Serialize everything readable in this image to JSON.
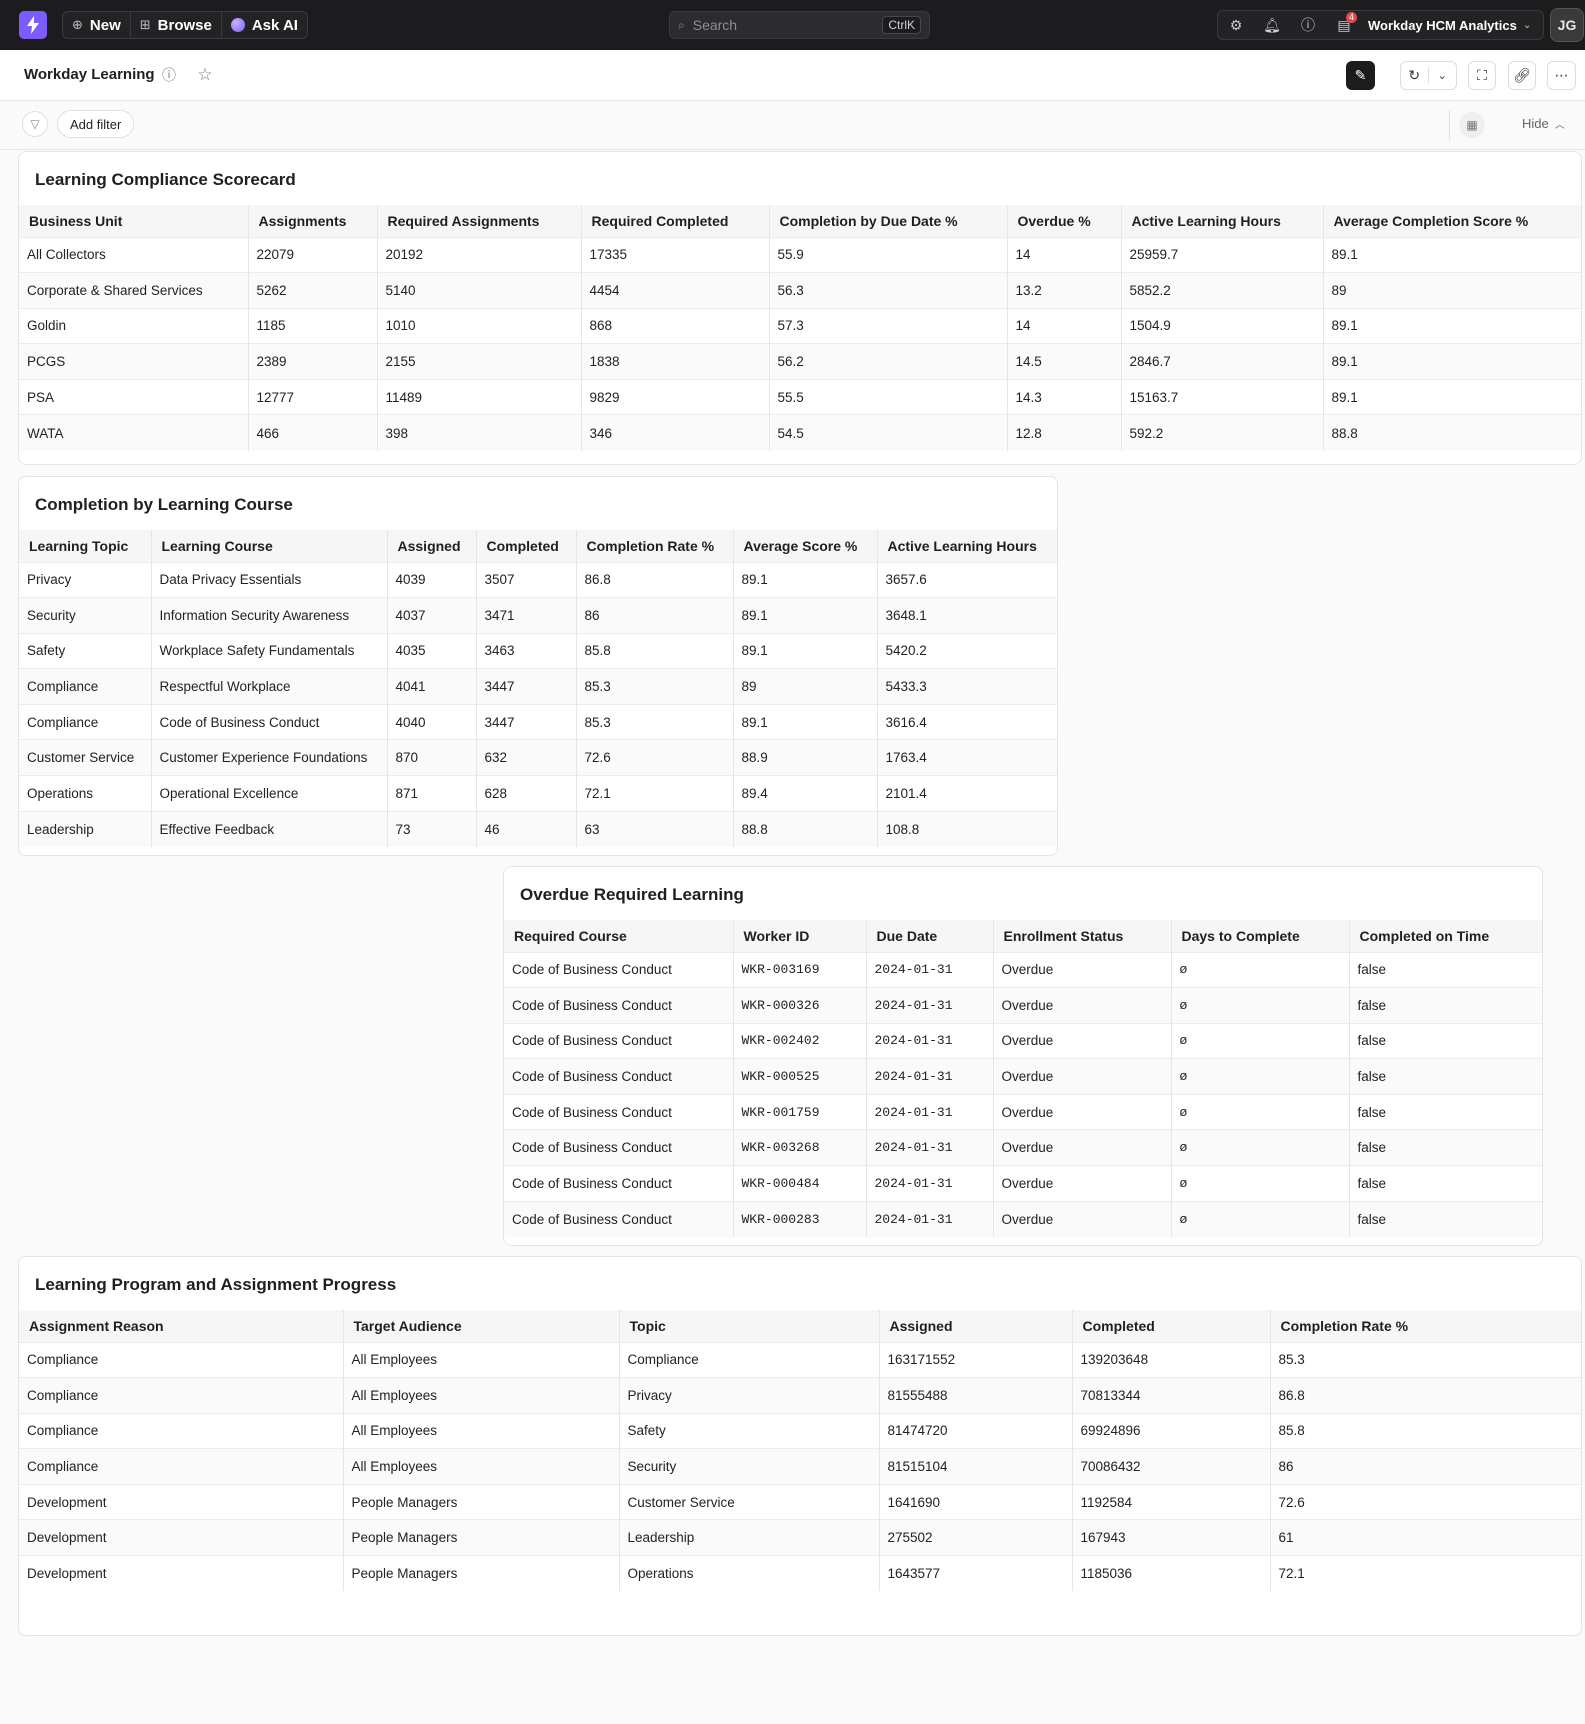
{
  "nav": {
    "new_label": "New",
    "browse_label": "Browse",
    "ask_ai_label": "Ask AI",
    "search_placeholder": "Search",
    "search_shortcut": "CtrlK",
    "notification_count": "4",
    "org_name": "Workday HCM Analytics",
    "avatar_initials": "JG"
  },
  "titlebar": {
    "title": "Workday Learning"
  },
  "filterbar": {
    "add_filter_label": "Add filter",
    "hide_label": "Hide"
  },
  "scorecard": {
    "title": "Learning Compliance Scorecard",
    "columns": [
      "Business Unit",
      "Assignments",
      "Required Assignments",
      "Required Completed",
      "Completion by Due Date %",
      "Overdue %",
      "Active Learning Hours",
      "Average Completion Score %"
    ],
    "rows": [
      [
        "All Collectors",
        "22079",
        "20192",
        "17335",
        "55.9",
        "14",
        "25959.7",
        "89.1"
      ],
      [
        "Corporate & Shared Services",
        "5262",
        "5140",
        "4454",
        "56.3",
        "13.2",
        "5852.2",
        "89"
      ],
      [
        "Goldin",
        "1185",
        "1010",
        "868",
        "57.3",
        "14",
        "1504.9",
        "89.1"
      ],
      [
        "PCGS",
        "2389",
        "2155",
        "1838",
        "56.2",
        "14.5",
        "2846.7",
        "89.1"
      ],
      [
        "PSA",
        "12777",
        "11489",
        "9829",
        "55.5",
        "14.3",
        "15163.7",
        "89.1"
      ],
      [
        "WATA",
        "466",
        "398",
        "346",
        "54.5",
        "12.8",
        "592.2",
        "88.8"
      ]
    ]
  },
  "course": {
    "title": "Completion by Learning Course",
    "columns": [
      "Learning Topic",
      "Learning Course",
      "Assigned",
      "Completed",
      "Completion Rate %",
      "Average Score %",
      "Active Learning Hours"
    ],
    "rows": [
      [
        "Privacy",
        "Data Privacy Essentials",
        "4039",
        "3507",
        "86.8",
        "89.1",
        "3657.6"
      ],
      [
        "Security",
        "Information Security Awareness",
        "4037",
        "3471",
        "86",
        "89.1",
        "3648.1"
      ],
      [
        "Safety",
        "Workplace Safety Fundamentals",
        "4035",
        "3463",
        "85.8",
        "89.1",
        "5420.2"
      ],
      [
        "Compliance",
        "Respectful Workplace",
        "4041",
        "3447",
        "85.3",
        "89",
        "5433.3"
      ],
      [
        "Compliance",
        "Code of Business Conduct",
        "4040",
        "3447",
        "85.3",
        "89.1",
        "3616.4"
      ],
      [
        "Customer Service",
        "Customer Experience Foundations",
        "870",
        "632",
        "72.6",
        "88.9",
        "1763.4"
      ],
      [
        "Operations",
        "Operational Excellence",
        "871",
        "628",
        "72.1",
        "89.4",
        "2101.4"
      ],
      [
        "Leadership",
        "Effective Feedback",
        "73",
        "46",
        "63",
        "88.8",
        "108.8"
      ]
    ]
  },
  "overdue": {
    "title": "Overdue Required Learning",
    "columns": [
      "Required Course",
      "Worker ID",
      "Due Date",
      "Enrollment Status",
      "Days to Complete",
      "Completed on Time"
    ],
    "rows": [
      [
        "Code of Business Conduct",
        "WKR-003169",
        "2024-01-31",
        "Overdue",
        "ø",
        "false"
      ],
      [
        "Code of Business Conduct",
        "WKR-000326",
        "2024-01-31",
        "Overdue",
        "ø",
        "false"
      ],
      [
        "Code of Business Conduct",
        "WKR-002402",
        "2024-01-31",
        "Overdue",
        "ø",
        "false"
      ],
      [
        "Code of Business Conduct",
        "WKR-000525",
        "2024-01-31",
        "Overdue",
        "ø",
        "false"
      ],
      [
        "Code of Business Conduct",
        "WKR-001759",
        "2024-01-31",
        "Overdue",
        "ø",
        "false"
      ],
      [
        "Code of Business Conduct",
        "WKR-003268",
        "2024-01-31",
        "Overdue",
        "ø",
        "false"
      ],
      [
        "Code of Business Conduct",
        "WKR-000484",
        "2024-01-31",
        "Overdue",
        "ø",
        "false"
      ],
      [
        "Code of Business Conduct",
        "WKR-000283",
        "2024-01-31",
        "Overdue",
        "ø",
        "false"
      ]
    ]
  },
  "program": {
    "title": "Learning Program and Assignment Progress",
    "columns": [
      "Assignment Reason",
      "Target Audience",
      "Topic",
      "Assigned",
      "Completed",
      "Completion Rate %"
    ],
    "rows": [
      [
        "Compliance",
        "All Employees",
        "Compliance",
        "163171552",
        "139203648",
        "85.3"
      ],
      [
        "Compliance",
        "All Employees",
        "Privacy",
        "81555488",
        "70813344",
        "86.8"
      ],
      [
        "Compliance",
        "All Employees",
        "Safety",
        "81474720",
        "69924896",
        "85.8"
      ],
      [
        "Compliance",
        "All Employees",
        "Security",
        "81515104",
        "70086432",
        "86"
      ],
      [
        "Development",
        "People Managers",
        "Customer Service",
        "1641690",
        "1192584",
        "72.6"
      ],
      [
        "Development",
        "People Managers",
        "Leadership",
        "275502",
        "167943",
        "61"
      ],
      [
        "Development",
        "People Managers",
        "Operations",
        "1643577",
        "1185036",
        "72.1"
      ]
    ]
  }
}
